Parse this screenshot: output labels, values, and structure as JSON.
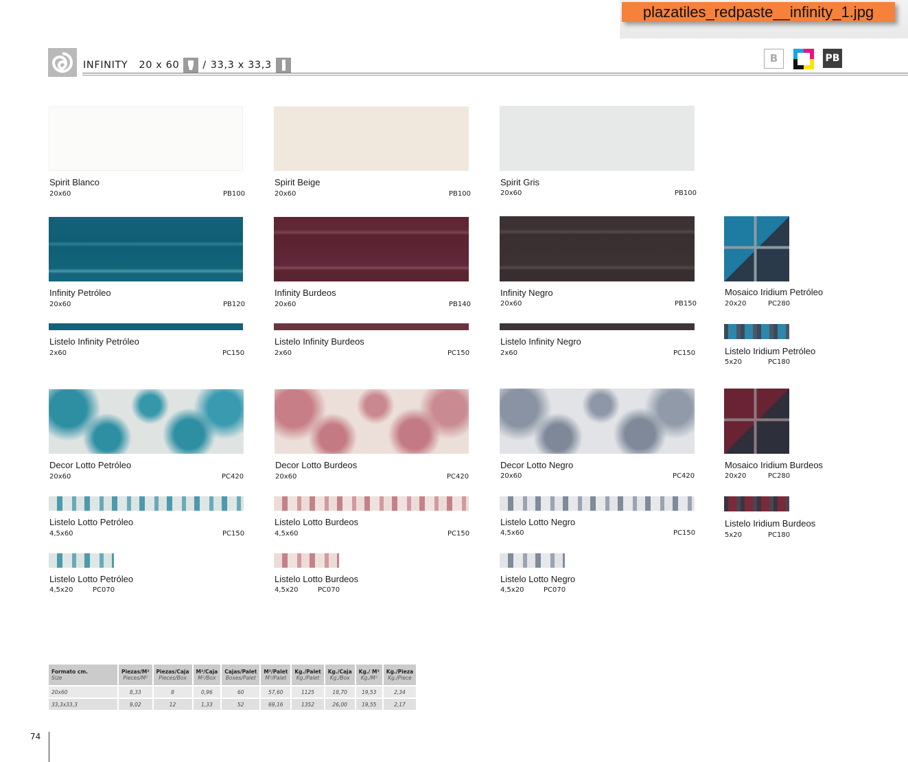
{
  "file_label": "plazatiles_redpaste__infinity_1.jpg",
  "header": {
    "collection": "INFINITY",
    "format_1": "20 x 60",
    "separator": "/",
    "format_2": "33,3 x 33,3",
    "badges": [
      "B",
      "PB"
    ]
  },
  "products": [
    {
      "name": "Spirit Blanco",
      "size": "20x60",
      "code": "PB100"
    },
    {
      "name": "Spirit Beige",
      "size": "20x60",
      "code": "PB100"
    },
    {
      "name": "Spirit Gris",
      "size": "20x60",
      "code": "PB100"
    },
    {
      "name": "Infinity Petróleo",
      "size": "20x60",
      "code": "PB120"
    },
    {
      "name": "Infinity Burdeos",
      "size": "20x60",
      "code": "PB140"
    },
    {
      "name": "Infinity Negro",
      "size": "20x60",
      "code": "PB150"
    },
    {
      "name": "Mosaico Iridium Petróleo",
      "size": "20x20",
      "code": "PC280"
    },
    {
      "name": "Listelo Infinity Petróleo",
      "size": "2x60",
      "code": "PC150"
    },
    {
      "name": "Listelo Infinity Burdeos",
      "size": "2x60",
      "code": "PC150"
    },
    {
      "name": "Listelo Infinity Negro",
      "size": "2x60",
      "code": "PC150"
    },
    {
      "name": "Listelo Iridium Petróleo",
      "size": "5x20",
      "code": "PC180"
    },
    {
      "name": "Decor Lotto Petróleo",
      "size": "20x60",
      "code": "PC420"
    },
    {
      "name": "Decor Lotto Burdeos",
      "size": "20x60",
      "code": "PC420"
    },
    {
      "name": "Decor Lotto Negro",
      "size": "20x60",
      "code": "PC420"
    },
    {
      "name": "Mosaico Iridium Burdeos",
      "size": "20x20",
      "code": "PC280"
    },
    {
      "name": "Listelo Lotto Petróleo",
      "size": "4,5x60",
      "code": "PC150"
    },
    {
      "name": "Listelo Lotto Burdeos",
      "size": "4,5x60",
      "code": "PC150"
    },
    {
      "name": "Listelo Lotto Negro",
      "size": "4,5x60",
      "code": "PC150"
    },
    {
      "name": "Listelo Iridium Burdeos",
      "size": "5x20",
      "code": "PC180"
    },
    {
      "name": "Listelo Lotto Petróleo",
      "size": "4,5x20",
      "code": "PC070"
    },
    {
      "name": "Listelo Lotto Burdeos",
      "size": "4,5x20",
      "code": "PC070"
    },
    {
      "name": "Listelo Lotto Negro",
      "size": "4,5x20",
      "code": "PC070"
    }
  ],
  "table": {
    "headers": [
      "Formato cm.",
      "Piezas/M²",
      "Piezas/Caja",
      "M²/Caja",
      "Cajas/Palet",
      "M²/Palet",
      "Kg./Palet",
      "Kg./Caja",
      "Kg./ M²",
      "Kg./Pieza"
    ],
    "subheaders": [
      "Size",
      "Pieces/M²",
      "Pieces/Box",
      "M²/Box",
      "Boxes/Palet",
      "M²/Palet",
      "Kg./Palet",
      "Kg./Box",
      "Kg./M²",
      "Kg./Piece"
    ],
    "rows": [
      [
        "20x60",
        "8,33",
        "8",
        "0,96",
        "60",
        "57,60",
        "1125",
        "18,70",
        "19,53",
        "2,34"
      ],
      [
        "33,3x33,3",
        "9,02",
        "12",
        "1,33",
        "52",
        "69,16",
        "1352",
        "26,00",
        "19,55",
        "2,17"
      ]
    ]
  },
  "page_number": "74",
  "colors": {
    "banner": "#f5813a",
    "petroleo": "#13627a",
    "burdeos": "#5f2531",
    "negro": "#3b3132"
  }
}
